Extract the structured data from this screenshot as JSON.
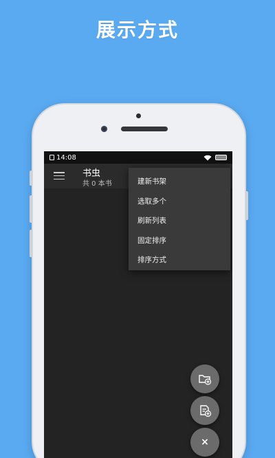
{
  "banner": {
    "text": "展示方式"
  },
  "statusbar": {
    "time": "14:08"
  },
  "toolbar": {
    "title": "书虫",
    "subtitle": "共 0 本书"
  },
  "popup_menu": {
    "items": [
      {
        "label": "建新书架"
      },
      {
        "label": "选取多个"
      },
      {
        "label": "刷新列表"
      },
      {
        "label": "固定排序"
      },
      {
        "label": "排序方式"
      }
    ]
  },
  "fabs": {
    "add_folder": {
      "icon": "folder-add-icon"
    },
    "add_file": {
      "icon": "file-add-icon"
    },
    "close": {
      "label": "×"
    }
  },
  "colors": {
    "background": "#5aaaf2",
    "screen": "#232323",
    "toolbar": "#2b2b2b",
    "popup": "#3a3a3a",
    "fab": "#6b6b6b"
  }
}
